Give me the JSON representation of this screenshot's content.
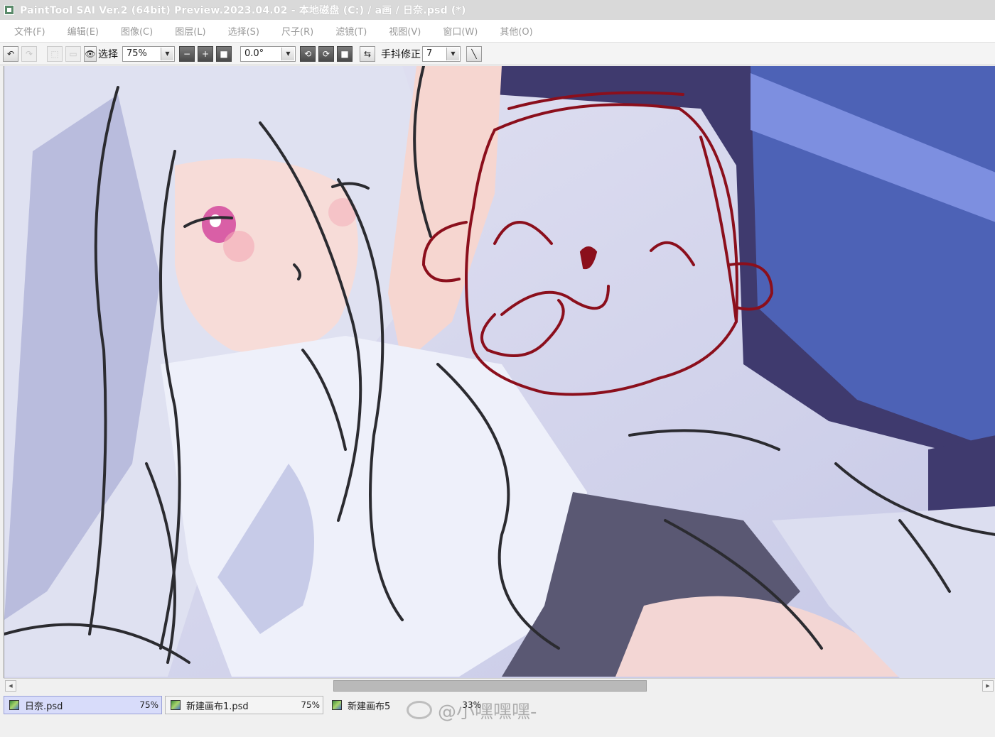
{
  "window": {
    "title": "PaintTool SAI Ver.2 (64bit) Preview.2023.04.02 - 本地磁盘 (C:) / a画 / 日奈.psd (*)"
  },
  "menu": [
    "文件(F)",
    "编辑(E)",
    "图像(C)",
    "图层(L)",
    "选择(S)",
    "尺子(R)",
    "滤镜(T)",
    "视图(V)",
    "窗口(W)",
    "其他(O)"
  ],
  "toolbar": {
    "selection_label": "选择",
    "zoom_value": "75%",
    "rotation_value": "0.0°",
    "stabilizer_label": "手抖修正",
    "stabilizer_value": "7"
  },
  "icons": {
    "undo": "undo-icon",
    "redo": "redo-icon",
    "eye": "eye-icon",
    "flip": "flip-horizontal-icon",
    "stroke": "line-stroke-icon"
  },
  "documents": [
    {
      "name": "日奈.psd",
      "zoom": "75%",
      "active": true
    },
    {
      "name": "新建画布1.psd",
      "zoom": "75%",
      "active": false
    },
    {
      "name": "新建画布5",
      "zoom": "33%",
      "active": false
    }
  ],
  "watermark": {
    "text": "@小嘿嘿嘿-"
  },
  "colors": {
    "title_bg": "#d9d9d9",
    "canvas_sketch": "#8b0f1c",
    "active_tab": "#d8dcfa"
  }
}
